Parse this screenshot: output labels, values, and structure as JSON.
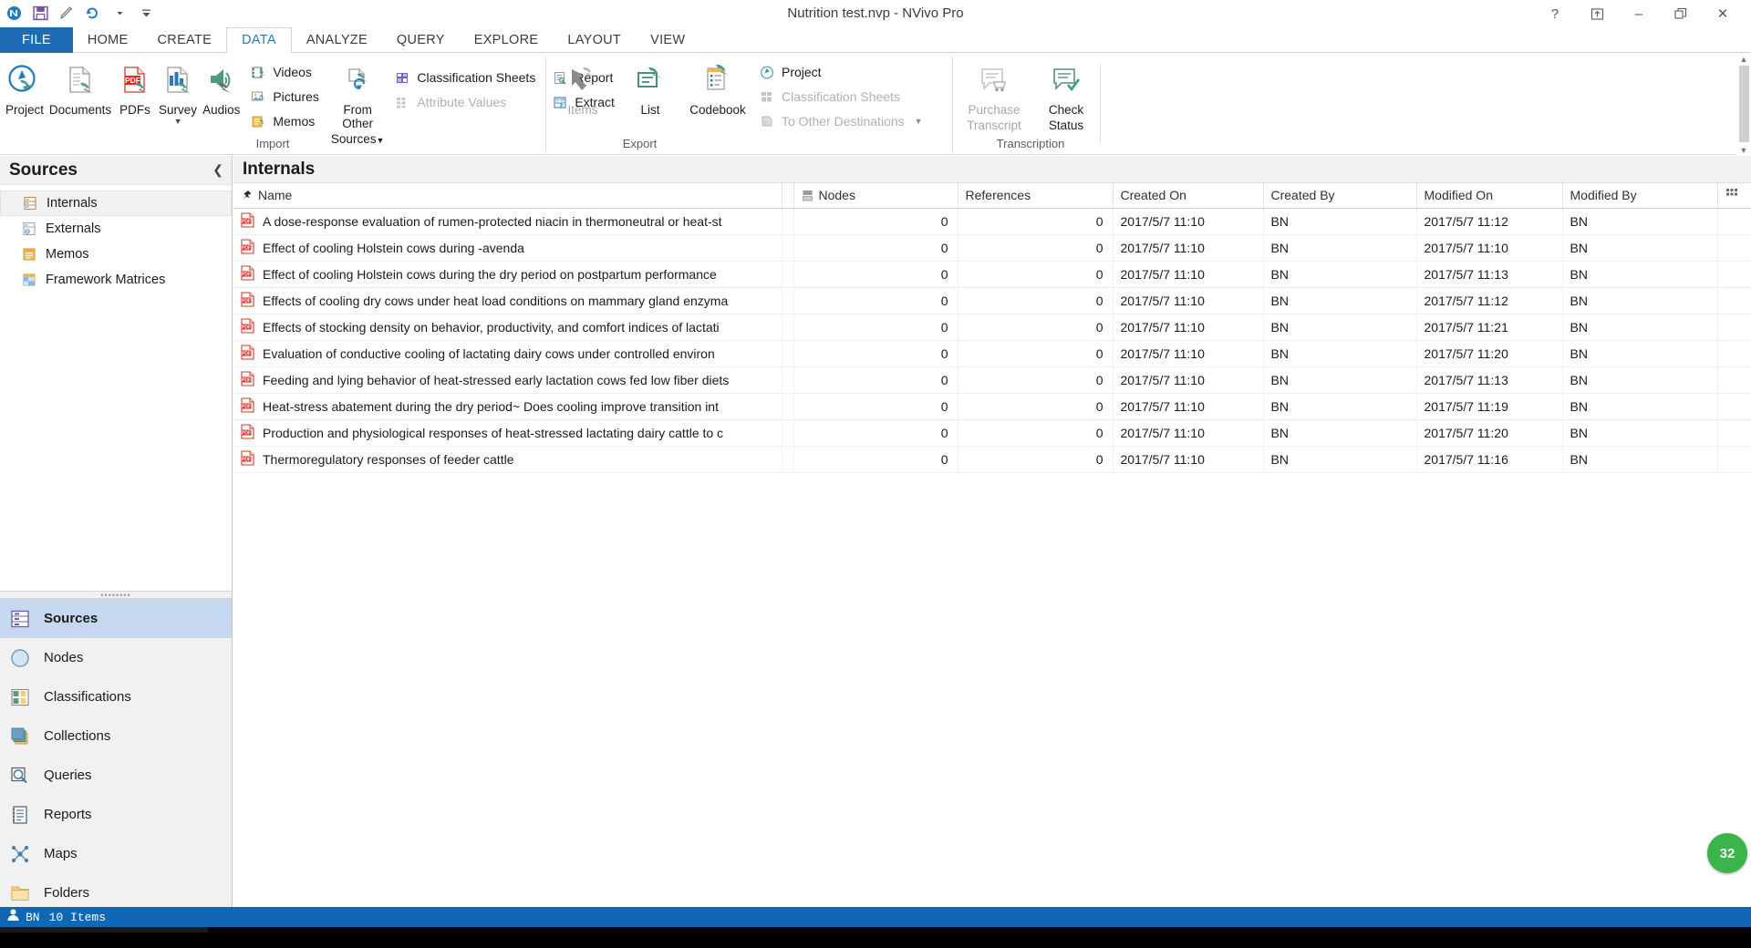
{
  "window": {
    "title": "Nutrition test.nvp - NVivo Pro",
    "quick_access": [
      "nvivo-logo-icon",
      "save-icon",
      "edit-pen-icon",
      "undo-icon",
      "qat-dropdown-icon"
    ],
    "controls": {
      "help": "?",
      "ribbon_display": "⬆",
      "minimize": "–",
      "restore": "❐",
      "close": "✕"
    }
  },
  "ribbon": {
    "tabs": [
      {
        "label": "FILE",
        "state": "file"
      },
      {
        "label": "HOME",
        "state": "normal"
      },
      {
        "label": "CREATE",
        "state": "normal"
      },
      {
        "label": "DATA",
        "state": "active"
      },
      {
        "label": "ANALYZE",
        "state": "normal"
      },
      {
        "label": "QUERY",
        "state": "normal"
      },
      {
        "label": "EXPLORE",
        "state": "normal"
      },
      {
        "label": "LAYOUT",
        "state": "normal"
      },
      {
        "label": "VIEW",
        "state": "normal"
      }
    ],
    "groups": [
      {
        "name": "import",
        "label": "Import",
        "big_buttons": [
          {
            "label": "Project",
            "icon": "import-project-icon",
            "enabled": true,
            "dropdown": false
          },
          {
            "label": "Documents",
            "icon": "import-documents-icon",
            "enabled": true,
            "dropdown": false
          },
          {
            "label": "PDFs",
            "icon": "import-pdfs-icon",
            "enabled": true,
            "dropdown": false
          },
          {
            "label": "Survey",
            "icon": "import-survey-icon",
            "enabled": true,
            "dropdown": true
          },
          {
            "label": "Audios",
            "icon": "import-audios-icon",
            "enabled": true,
            "dropdown": false
          }
        ],
        "small_buttons": [
          {
            "label": "Videos",
            "icon": "videos-icon",
            "enabled": true
          },
          {
            "label": "Pictures",
            "icon": "pictures-icon",
            "enabled": true
          },
          {
            "label": "Memos",
            "icon": "memos-icon",
            "enabled": true
          }
        ],
        "from_other": {
          "label_line1": "From Other",
          "label_line2": "Sources",
          "icon": "from-other-sources-icon",
          "dropdown": true
        },
        "classification": [
          {
            "label": "Classification Sheets",
            "icon": "classification-sheets-icon",
            "enabled": true
          },
          {
            "label": "Attribute Values",
            "icon": "attribute-values-icon",
            "enabled": false
          }
        ],
        "reports": [
          {
            "label": "Report",
            "icon": "report-icon",
            "enabled": true
          },
          {
            "label": "Extract",
            "icon": "extract-icon",
            "enabled": true
          }
        ]
      },
      {
        "name": "export",
        "label": "Export",
        "big_buttons": [
          {
            "label": "Items",
            "icon": "export-items-icon",
            "enabled": false,
            "dropdown": false
          },
          {
            "label": "List",
            "icon": "export-list-icon",
            "enabled": true,
            "dropdown": false
          },
          {
            "label": "Codebook",
            "icon": "export-codebook-icon",
            "enabled": true,
            "dropdown": false
          }
        ],
        "small_buttons": [
          {
            "label": "Project",
            "icon": "export-project-icon",
            "enabled": true
          },
          {
            "label": "Classification Sheets",
            "icon": "export-classification-sheets-icon",
            "enabled": false
          },
          {
            "label": "To Other Destinations",
            "icon": "to-other-destinations-icon",
            "enabled": false,
            "dropdown": true
          }
        ]
      },
      {
        "name": "transcription",
        "label": "Transcription",
        "big_buttons": [
          {
            "label_line1": "Purchase",
            "label_line2": "Transcript",
            "icon": "purchase-transcript-icon",
            "enabled": false
          },
          {
            "label_line1": "Check",
            "label_line2": "Status",
            "icon": "check-status-icon",
            "enabled": true
          }
        ]
      }
    ]
  },
  "sidebar": {
    "header": "Sources",
    "collapse_icon": "chevron-left-icon",
    "tree": [
      {
        "label": "Internals",
        "icon": "internals-icon",
        "selected": true
      },
      {
        "label": "Externals",
        "icon": "externals-icon",
        "selected": false
      },
      {
        "label": "Memos",
        "icon": "memos-folder-icon",
        "selected": false
      },
      {
        "label": "Framework Matrices",
        "icon": "framework-matrices-icon",
        "selected": false
      }
    ],
    "nav_items": [
      {
        "label": "Sources",
        "icon": "sources-icon",
        "active": true
      },
      {
        "label": "Nodes",
        "icon": "nodes-icon",
        "active": false
      },
      {
        "label": "Classifications",
        "icon": "classifications-icon",
        "active": false
      },
      {
        "label": "Collections",
        "icon": "collections-icon",
        "active": false
      },
      {
        "label": "Queries",
        "icon": "queries-icon",
        "active": false
      },
      {
        "label": "Reports",
        "icon": "reports-icon",
        "active": false
      },
      {
        "label": "Maps",
        "icon": "maps-icon",
        "active": false
      },
      {
        "label": "Folders",
        "icon": "folders-icon",
        "active": false
      }
    ]
  },
  "main": {
    "title": "Internals",
    "columns": [
      {
        "label": "Name",
        "icon": "pin-icon"
      },
      {
        "label": "Nodes",
        "icon": "nodes-column-icon"
      },
      {
        "label": "References",
        "icon": null
      },
      {
        "label": "Created On",
        "icon": null
      },
      {
        "label": "Created By",
        "icon": null
      },
      {
        "label": "Modified On",
        "icon": null
      },
      {
        "label": "Modified By",
        "icon": null
      },
      {
        "label": "",
        "icon": "column-chooser-icon"
      }
    ],
    "rows": [
      {
        "icon": "pdf-icon",
        "name": "A dose-response evaluation of rumen-protected niacin in thermoneutral or heat-st",
        "nodes": "0",
        "references": "0",
        "created_on": "2017/5/7 11:10",
        "created_by": "BN",
        "modified_on": "2017/5/7 11:12",
        "modified_by": "BN"
      },
      {
        "icon": "pdf-icon",
        "name": "Effect of cooling Holstein cows during -avenda",
        "nodes": "0",
        "references": "0",
        "created_on": "2017/5/7 11:10",
        "created_by": "BN",
        "modified_on": "2017/5/7 11:10",
        "modified_by": "BN"
      },
      {
        "icon": "pdf-icon",
        "name": "Effect of cooling Holstein cows during the dry period on postpartum performance",
        "nodes": "0",
        "references": "0",
        "created_on": "2017/5/7 11:10",
        "created_by": "BN",
        "modified_on": "2017/5/7 11:13",
        "modified_by": "BN"
      },
      {
        "icon": "pdf-icon",
        "name": "Effects of cooling dry cows under heat load conditions on mammary gland enzyma",
        "nodes": "0",
        "references": "0",
        "created_on": "2017/5/7 11:10",
        "created_by": "BN",
        "modified_on": "2017/5/7 11:12",
        "modified_by": "BN"
      },
      {
        "icon": "pdf-icon",
        "name": "Effects of stocking density on behavior, productivity, and comfort indices of lactati",
        "nodes": "0",
        "references": "0",
        "created_on": "2017/5/7 11:10",
        "created_by": "BN",
        "modified_on": "2017/5/7 11:21",
        "modified_by": "BN"
      },
      {
        "icon": "pdf-icon",
        "name": "Evaluation of conductive cooling of lactating dairy cows under controlled environ",
        "nodes": "0",
        "references": "0",
        "created_on": "2017/5/7 11:10",
        "created_by": "BN",
        "modified_on": "2017/5/7 11:20",
        "modified_by": "BN"
      },
      {
        "icon": "pdf-icon",
        "name": "Feeding and lying behavior of heat-stressed early lactation cows fed low fiber diets",
        "nodes": "0",
        "references": "0",
        "created_on": "2017/5/7 11:10",
        "created_by": "BN",
        "modified_on": "2017/5/7 11:13",
        "modified_by": "BN"
      },
      {
        "icon": "pdf-icon",
        "name": "Heat-stress abatement during the dry period~ Does cooling improve transition int",
        "nodes": "0",
        "references": "0",
        "created_on": "2017/5/7 11:10",
        "created_by": "BN",
        "modified_on": "2017/5/7 11:19",
        "modified_by": "BN"
      },
      {
        "icon": "pdf-icon",
        "name": "Production and physiological responses of heat-stressed lactating dairy cattle to c",
        "nodes": "0",
        "references": "0",
        "created_on": "2017/5/7 11:10",
        "created_by": "BN",
        "modified_on": "2017/5/7 11:20",
        "modified_by": "BN"
      },
      {
        "icon": "pdf-icon",
        "name": "Thermoregulatory responses of feeder cattle",
        "nodes": "0",
        "references": "0",
        "created_on": "2017/5/7 11:10",
        "created_by": "BN",
        "modified_on": "2017/5/7 11:16",
        "modified_by": "BN"
      }
    ]
  },
  "statusbar": {
    "user_icon": "user-icon",
    "user": "BN",
    "item_count": "10 Items"
  },
  "badge": {
    "label": "32"
  },
  "colors": {
    "accent_blue": "#1e6cb5",
    "status_blue": "#1068b5",
    "tab_active_text": "#2a7ab8",
    "nav_active": "#c5d8ef",
    "badge_green": "#3bb44a",
    "pdf_red": "#e02b20"
  }
}
